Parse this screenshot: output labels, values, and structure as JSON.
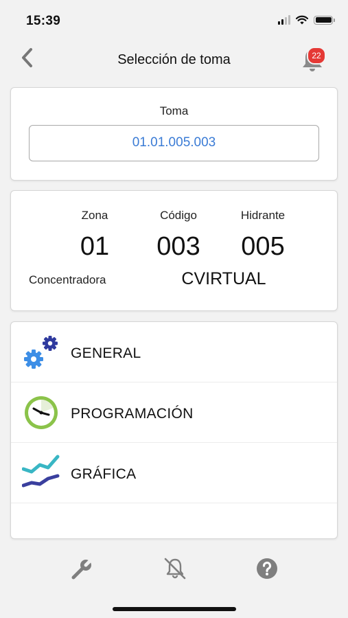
{
  "status_bar": {
    "time": "15:39"
  },
  "nav": {
    "title": "Selección de toma",
    "notification_count": "22"
  },
  "toma": {
    "label": "Toma",
    "value": "01.01.005.003"
  },
  "info": {
    "zona_label": "Zona",
    "zona_value": "01",
    "codigo_label": "Código",
    "codigo_value": "003",
    "hidrante_label": "Hidrante",
    "hidrante_value": "005",
    "concentradora_label": "Concentradora",
    "concentradora_value": "CVIRTUAL"
  },
  "menu": {
    "items": [
      {
        "label": "GENERAL",
        "icon": "gears-icon"
      },
      {
        "label": "PROGRAMACIÓN",
        "icon": "clock-icon"
      },
      {
        "label": "GRÁFICA",
        "icon": "chart-icon"
      }
    ]
  },
  "tab_bar": {
    "icons": [
      "wrench-icon",
      "bell-off-icon",
      "help-icon"
    ]
  },
  "colors": {
    "accent_blue": "#3a7bd5",
    "badge_red": "#e53935",
    "gear_light": "#3d8ee6",
    "gear_dark": "#2f3a9e",
    "clock_green": "#8bc34a",
    "chart_teal": "#39b6c4",
    "chart_navy": "#3a3f9e"
  }
}
